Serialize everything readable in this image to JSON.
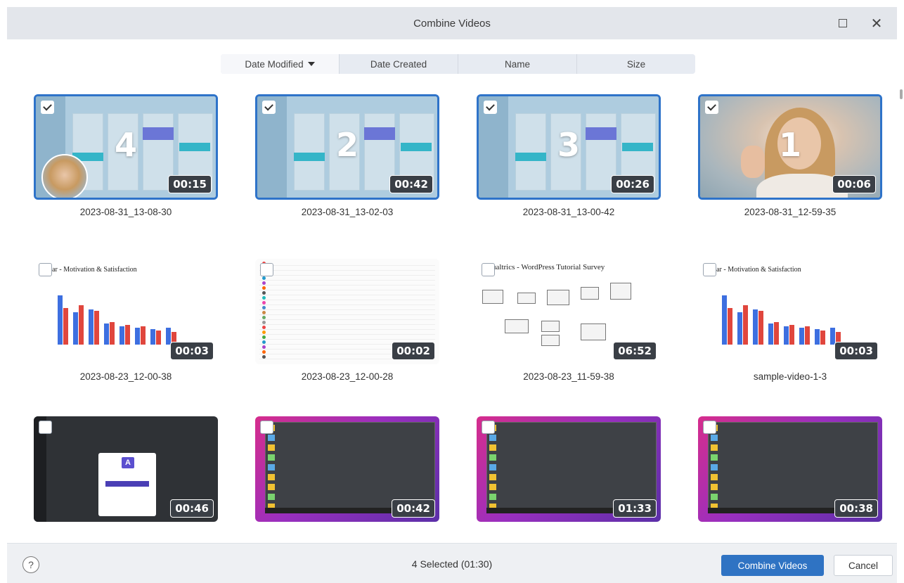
{
  "window": {
    "title": "Combine Videos",
    "maximize_icon": "maximize-icon",
    "close_icon": "close-icon"
  },
  "sort": {
    "tabs": [
      {
        "label": "Date Modified",
        "active": true,
        "icon": "chevron-down-icon"
      },
      {
        "label": "Date Created",
        "active": false
      },
      {
        "label": "Name",
        "active": false
      },
      {
        "label": "Size",
        "active": false
      }
    ]
  },
  "videos": [
    {
      "name": "2023-08-31_13-08-30",
      "duration": "00:15",
      "selected": true,
      "order": "4",
      "thumb": "app-with-webcam"
    },
    {
      "name": "2023-08-31_13-02-03",
      "duration": "00:42",
      "selected": true,
      "order": "2",
      "thumb": "app"
    },
    {
      "name": "2023-08-31_13-00-42",
      "duration": "00:26",
      "selected": true,
      "order": "3",
      "thumb": "app"
    },
    {
      "name": "2023-08-31_12-59-35",
      "duration": "00:06",
      "selected": true,
      "order": "1",
      "thumb": "photo"
    },
    {
      "name": "2023-08-23_12-00-38",
      "duration": "00:03",
      "selected": false,
      "order": "",
      "thumb": "chart",
      "heading": "rjar - Motivation & Satisfaction"
    },
    {
      "name": "2023-08-23_12-00-28",
      "duration": "00:02",
      "selected": false,
      "order": "",
      "thumb": "list"
    },
    {
      "name": "2023-08-23_11-59-38",
      "duration": "06:52",
      "selected": false,
      "order": "",
      "thumb": "flow",
      "heading": "ualtrics - WordPress Tutorial Survey"
    },
    {
      "name": "sample-video-1-3",
      "duration": "00:03",
      "selected": false,
      "order": "",
      "thumb": "chart",
      "heading": "rjar - Motivation & Satisfaction"
    },
    {
      "name": "",
      "duration": "00:46",
      "selected": false,
      "order": "",
      "thumb": "dark"
    },
    {
      "name": "",
      "duration": "00:42",
      "selected": false,
      "order": "",
      "thumb": "desk"
    },
    {
      "name": "",
      "duration": "01:33",
      "selected": false,
      "order": "",
      "thumb": "desk"
    },
    {
      "name": "",
      "duration": "00:38",
      "selected": false,
      "order": "",
      "thumb": "desk"
    }
  ],
  "footer": {
    "help_label": "?",
    "status": "4 Selected (01:30)",
    "combine_label": "Combine Videos",
    "cancel_label": "Cancel"
  },
  "colors": {
    "accent": "#2f73c3",
    "selected_border": "#2e73c9",
    "titlebar": "#e3e6eb"
  }
}
